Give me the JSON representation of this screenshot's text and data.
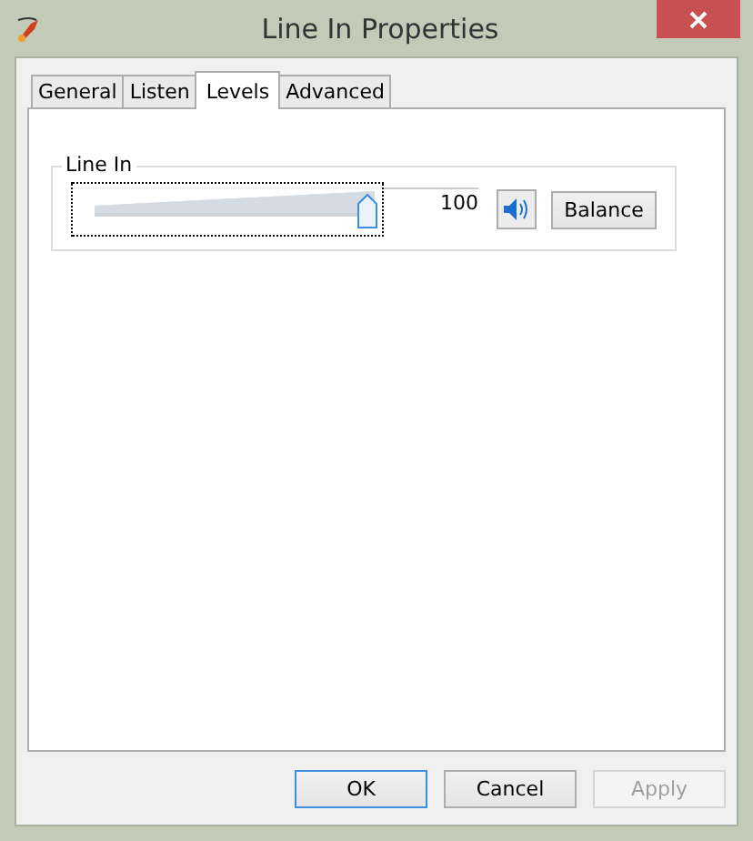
{
  "window": {
    "title": "Line In Properties"
  },
  "tabs": [
    {
      "label": "General",
      "selected": false
    },
    {
      "label": "Listen",
      "selected": false
    },
    {
      "label": "Levels",
      "selected": true
    },
    {
      "label": "Advanced",
      "selected": false
    }
  ],
  "group": {
    "label": "Line In",
    "slider": {
      "level": 1.0,
      "focused": true
    },
    "reading": "100",
    "muted": false,
    "balance_button": "Balance"
  },
  "buttons": [
    {
      "label": "OK",
      "default": true,
      "disabled": false
    },
    {
      "label": "Cancel",
      "default": false,
      "disabled": false
    },
    {
      "label": "Apply",
      "default": false,
      "disabled": true
    }
  ]
}
